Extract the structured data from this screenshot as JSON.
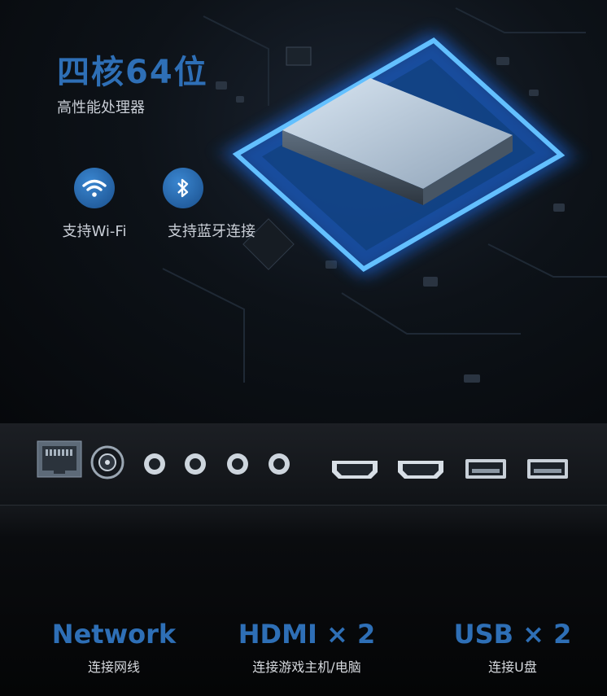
{
  "header": {
    "title": "四核64位",
    "subtitle": "高性能处理器"
  },
  "features": [
    {
      "label": "支持Wi-Fi",
      "icon": "wifi-icon"
    },
    {
      "label": "支持蓝牙连接",
      "icon": "bluetooth-icon"
    }
  ],
  "specs": [
    {
      "title": "Network",
      "caption": "连接网线"
    },
    {
      "title": "HDMI × 2",
      "caption": "连接游戏主机/电脑"
    },
    {
      "title": "USB × 2",
      "caption": "连接U盘"
    }
  ],
  "colors": {
    "accent": "#2e6fb6",
    "chip_glow": "#3aa0ff",
    "background": "#06080b"
  }
}
